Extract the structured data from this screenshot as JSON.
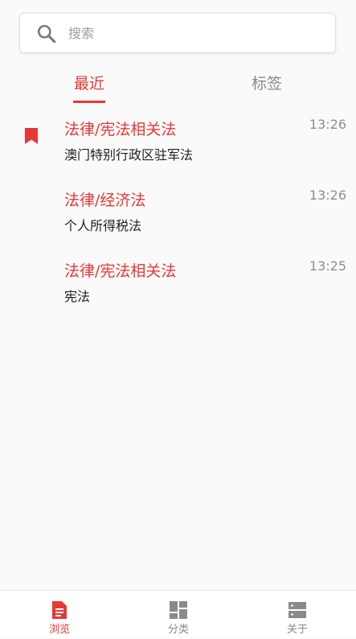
{
  "search": {
    "placeholder": "搜索"
  },
  "tabs": [
    {
      "label": "最近",
      "active": true
    },
    {
      "label": "标签",
      "active": false
    }
  ],
  "list": [
    {
      "category": "法律/宪法相关法",
      "title": "澳门特别行政区驻军法",
      "time": "13:26",
      "bookmarked": true
    },
    {
      "category": "法律/经济法",
      "title": "个人所得税法",
      "time": "13:26",
      "bookmarked": false
    },
    {
      "category": "法律/宪法相关法",
      "title": "宪法",
      "time": "13:25",
      "bookmarked": false
    }
  ],
  "bottom_nav": [
    {
      "label": "浏览",
      "icon": "document-icon",
      "active": true
    },
    {
      "label": "分类",
      "icon": "dashboard-icon",
      "active": false
    },
    {
      "label": "关于",
      "icon": "storage-icon",
      "active": false
    }
  ],
  "colors": {
    "accent": "#e53935",
    "inactive": "#8a8a8a",
    "background": "#fafafa"
  }
}
